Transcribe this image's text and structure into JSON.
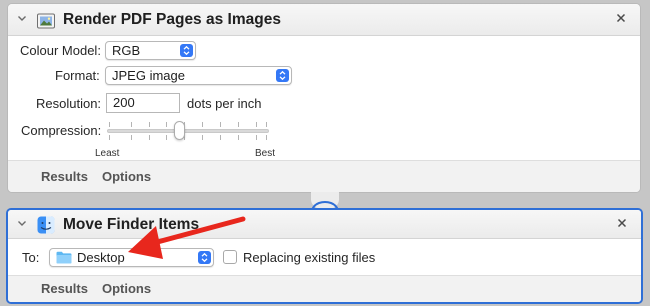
{
  "render_card": {
    "title": "Render PDF Pages as Images",
    "colour_model": {
      "label": "Colour Model:",
      "value": "RGB"
    },
    "format": {
      "label": "Format:",
      "value": "JPEG image"
    },
    "resolution": {
      "label": "Resolution:",
      "value": "200",
      "unit": "dots per inch"
    },
    "compression": {
      "label": "Compression:",
      "min_label": "Least",
      "max_label": "Best",
      "level": 0.45
    },
    "footer": {
      "results": "Results",
      "options": "Options"
    }
  },
  "move_card": {
    "title": "Move Finder Items",
    "to": {
      "label": "To:",
      "value": "Desktop"
    },
    "replacing": {
      "label": "Replacing existing files",
      "checked": false
    },
    "footer": {
      "results": "Results",
      "options": "Options"
    },
    "selected_border_color": "#2f6fd6"
  },
  "annotation": {
    "arrow_color": "#e8271d"
  },
  "icons": {
    "card_toggle": "chevron-down-icon",
    "render_action": "preview-app-icon",
    "move_action": "finder-icon",
    "close": "close-icon",
    "folder": "folder-icon"
  }
}
